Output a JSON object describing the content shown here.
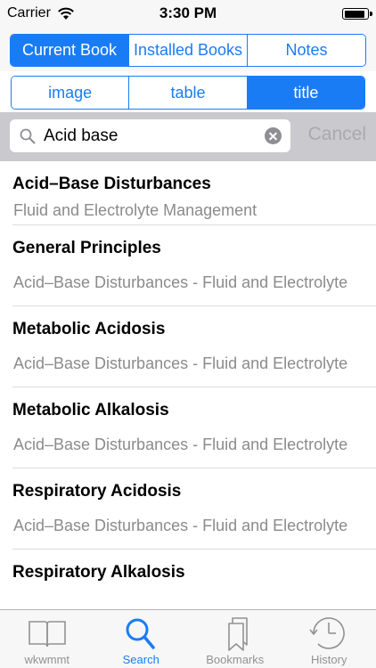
{
  "status_bar": {
    "carrier": "Carrier",
    "time": "3:30 PM",
    "battery_level": 0.92
  },
  "source_tabs": [
    {
      "label": "Current Book",
      "active": true
    },
    {
      "label": "Installed Books",
      "active": false
    },
    {
      "label": "Notes",
      "active": false
    }
  ],
  "filter_tabs": [
    {
      "label": "image",
      "active": false
    },
    {
      "label": "table",
      "active": false
    },
    {
      "label": "title",
      "active": true
    }
  ],
  "search": {
    "value": "Acid base",
    "cancel_label": "Cancel"
  },
  "results": [
    {
      "title": "Acid–Base Disturbances",
      "subtitle": "Fluid and Electrolyte Management"
    },
    {
      "title": "General Principles",
      "subtitle": "Acid–Base Disturbances - Fluid and Electrolyte"
    },
    {
      "title": "Metabolic Acidosis",
      "subtitle": "Acid–Base Disturbances - Fluid and Electrolyte"
    },
    {
      "title": "Metabolic Alkalosis",
      "subtitle": "Acid–Base Disturbances - Fluid and Electrolyte"
    },
    {
      "title": "Respiratory Acidosis",
      "subtitle": "Acid–Base Disturbances - Fluid and Electrolyte"
    },
    {
      "title": "Respiratory Alkalosis",
      "subtitle": ""
    }
  ],
  "tab_bar": [
    {
      "label": "wkwmmt",
      "icon": "book-icon",
      "active": false
    },
    {
      "label": "Search",
      "icon": "search-icon",
      "active": true
    },
    {
      "label": "Bookmarks",
      "icon": "bookmarks-icon",
      "active": false
    },
    {
      "label": "History",
      "icon": "history-icon",
      "active": false
    }
  ],
  "colors": {
    "accent": "#1a7cf5",
    "inactive_tab": "#929292",
    "subtitle": "#8b8b8b"
  }
}
